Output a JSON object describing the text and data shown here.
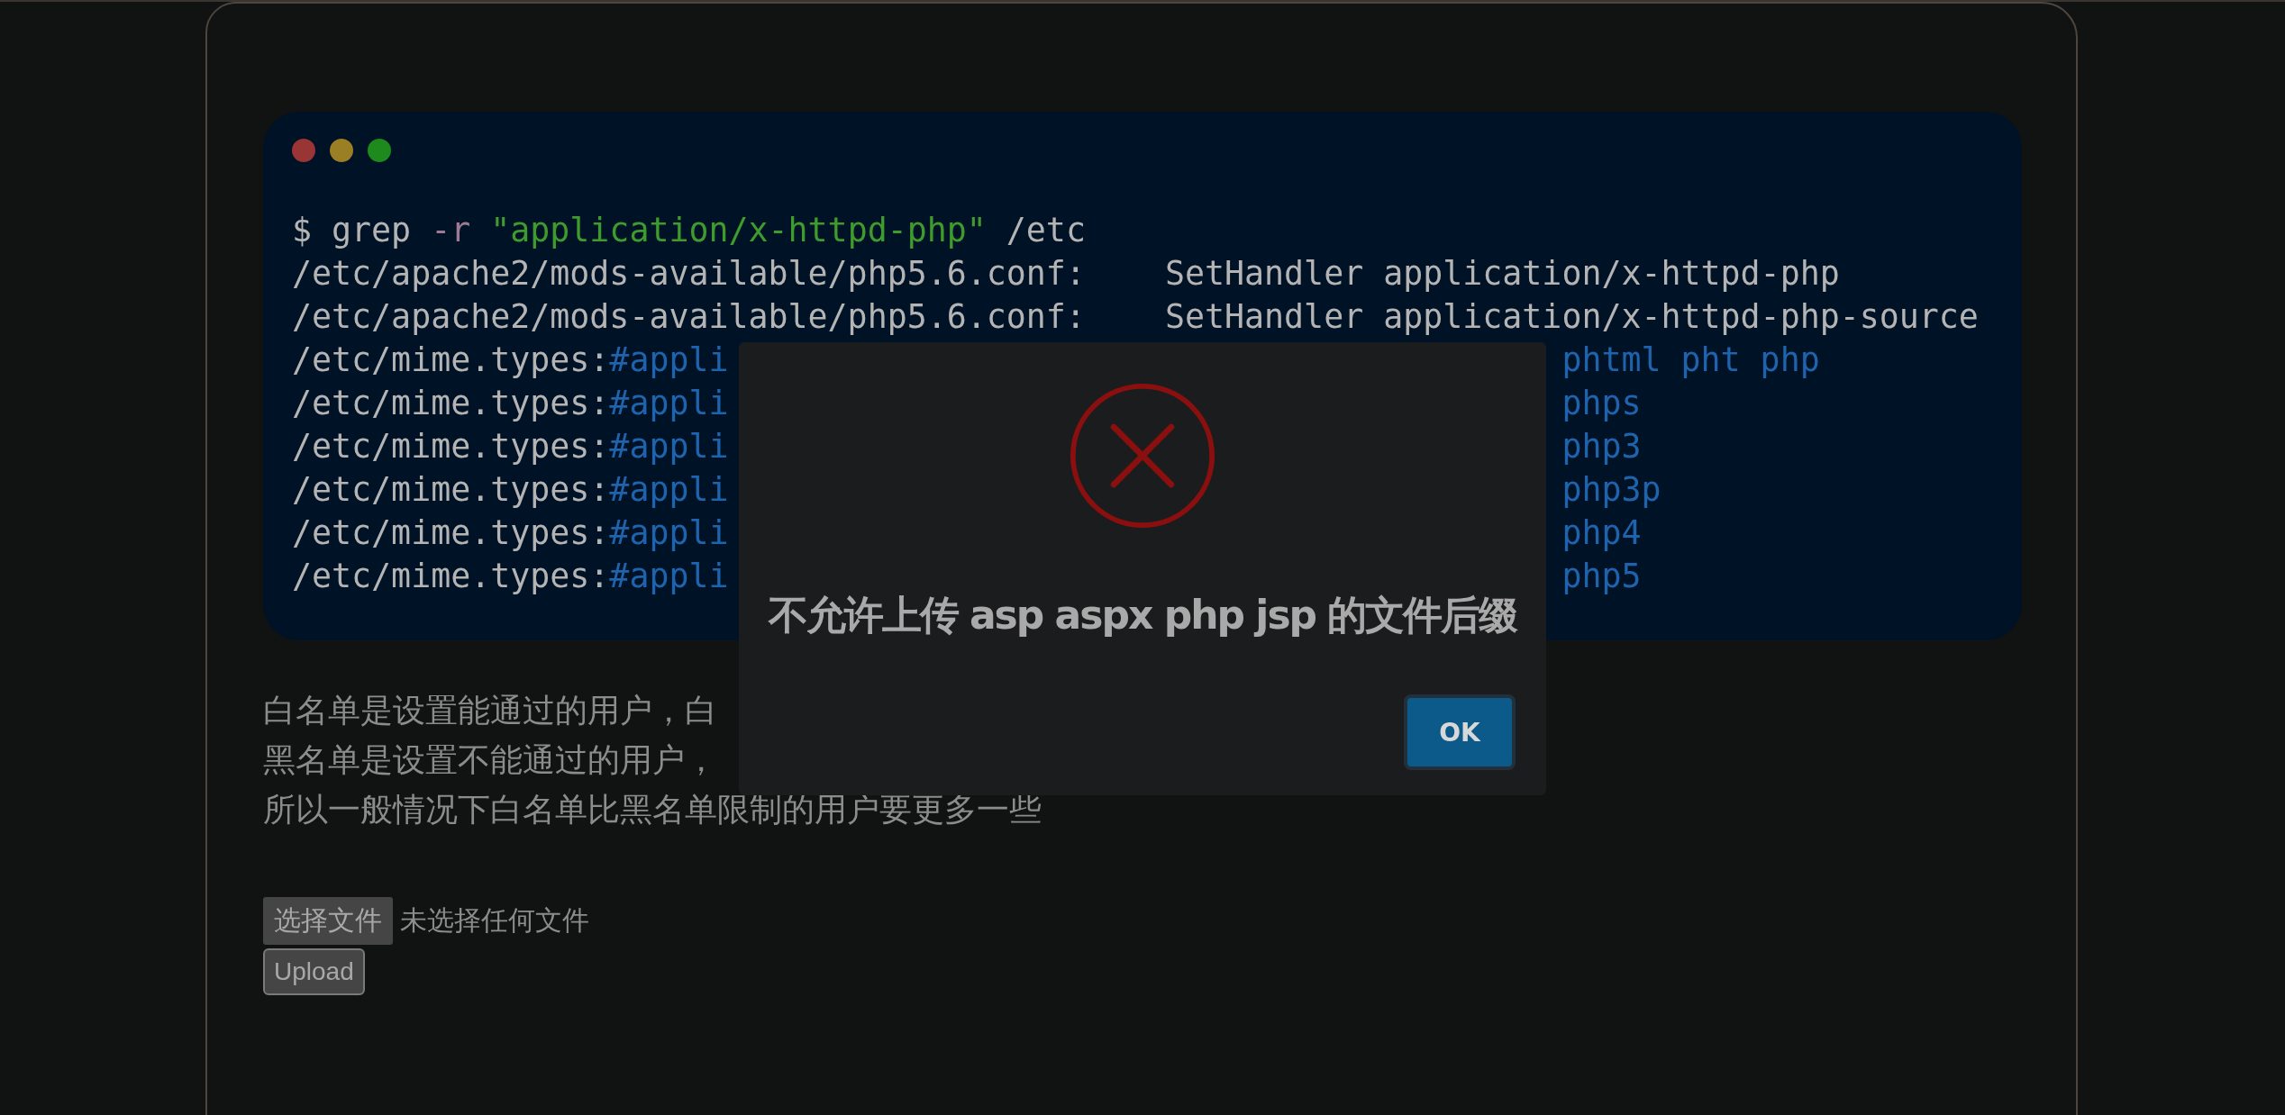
{
  "terminal": {
    "lines": [
      {
        "kind": "command",
        "prompt": "$",
        "cmd": "grep",
        "flag": "-r",
        "arg": "\"application/x-httpd-php\"",
        "path": "/etc"
      },
      {
        "kind": "handler",
        "file": "/etc/apache2/mods-available/php5.6.conf:",
        "value": "SetHandler application/x-httpd-php"
      },
      {
        "kind": "handler",
        "file": "/etc/apache2/mods-available/php5.6.conf:",
        "value": "SetHandler application/x-httpd-php-source"
      },
      {
        "kind": "mime",
        "file": "/etc/mime.types:",
        "comment": "#appli",
        "value": "phtml pht php"
      },
      {
        "kind": "mime",
        "file": "/etc/mime.types:",
        "comment": "#appli",
        "value": "phps"
      },
      {
        "kind": "mime",
        "file": "/etc/mime.types:",
        "comment": "#appli",
        "value": "php3"
      },
      {
        "kind": "mime",
        "file": "/etc/mime.types:",
        "comment": "#appli",
        "value": "php3p"
      },
      {
        "kind": "mime",
        "file": "/etc/mime.types:",
        "comment": "#appli",
        "value": "php4"
      },
      {
        "kind": "mime",
        "file": "/etc/mime.types:",
        "comment": "#appli",
        "value": "php5"
      }
    ]
  },
  "paragraph": [
    "白名单是设置能通过的用户，白",
    "黑名单是设置不能通过的用户，",
    "所以一般情况下白名单比黑名单限制的用户要更多一些"
  ],
  "file_input": {
    "button": "选择文件",
    "status": "未选择任何文件"
  },
  "upload_button": "Upload",
  "dialog": {
    "kind": "error",
    "message": "不允许上传 asp aspx php jsp 的文件后缀",
    "button": "OK"
  }
}
